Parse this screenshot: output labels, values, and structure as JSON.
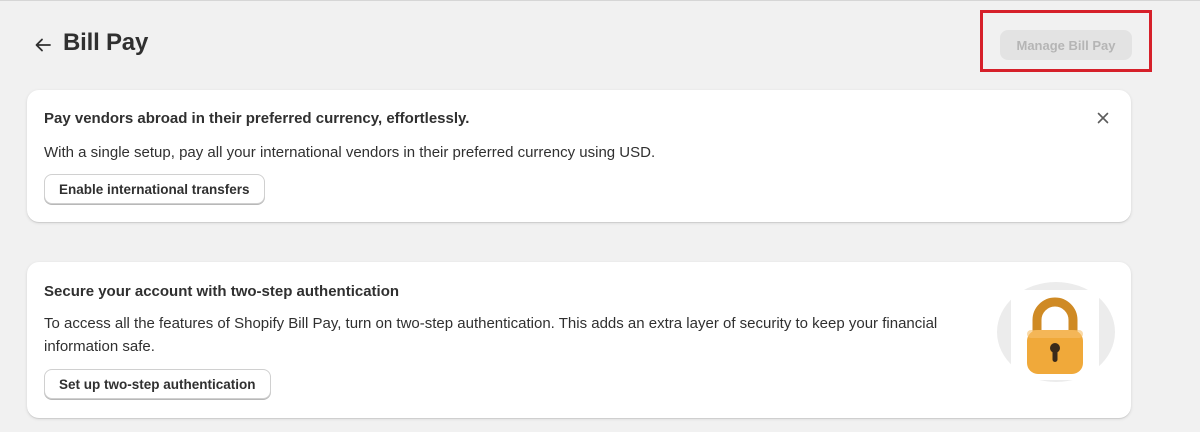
{
  "page": {
    "title": "Bill Pay",
    "primary_action": "Manage Bill Pay"
  },
  "banners": [
    {
      "title": "Pay vendors abroad in their preferred currency, effortlessly.",
      "body": "With a single setup, pay all your international vendors in their preferred currency using USD.",
      "button": "Enable international transfers",
      "dismiss_icon": "close-icon"
    },
    {
      "title": "Secure your account with two-step authentication",
      "body": "To access all the features of Shopify Bill Pay, turn on two-step authentication. This adds an extra layer of security to keep your financial information safe.",
      "button": "Set up two-step authentication",
      "illustration_icon": "padlock-icon"
    }
  ],
  "colors": {
    "background": "#f1f1f1",
    "card": "#ffffff",
    "text": "#303030",
    "disabled_button": "#e3e3e3",
    "disabled_text": "#b5b5b5",
    "highlight": "#d6202a",
    "lock_body": "#f0a93a",
    "lock_shackle": "#cf8a24"
  },
  "icons": {
    "back": "arrow-left-icon"
  }
}
